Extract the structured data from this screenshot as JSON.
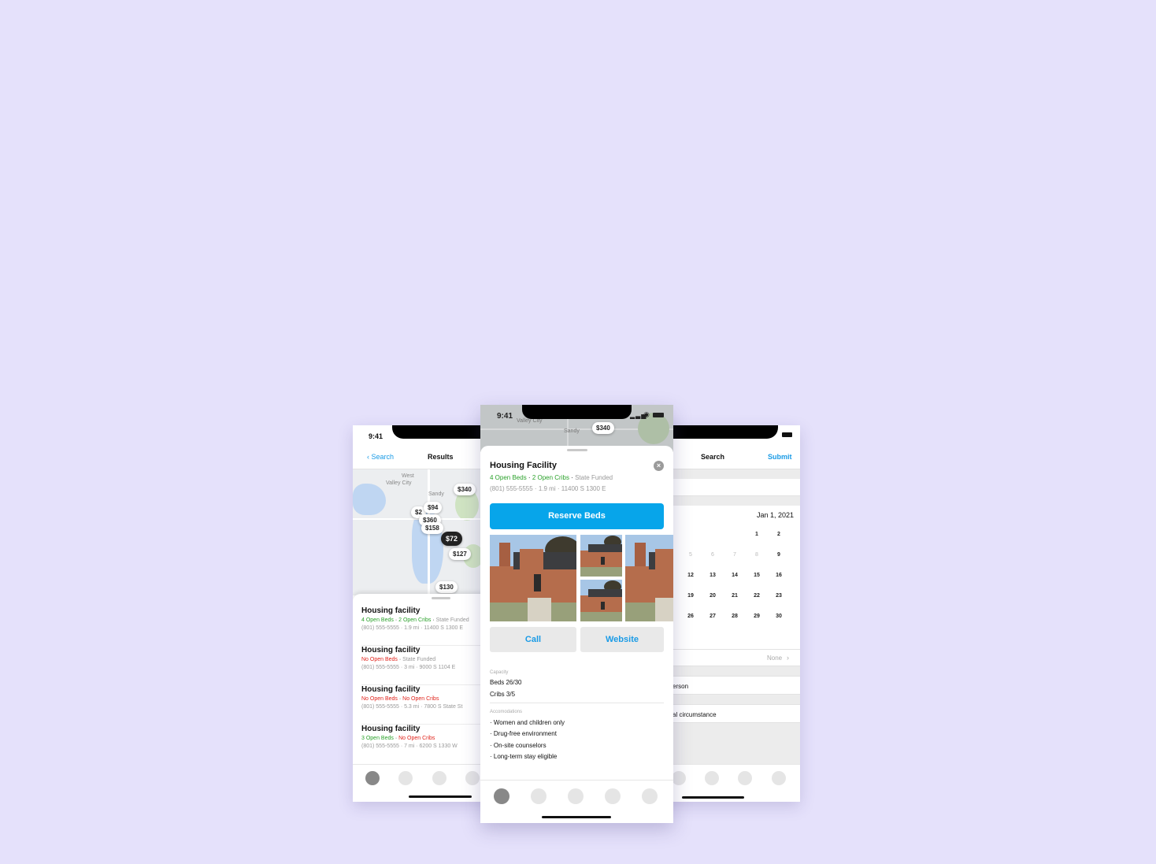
{
  "left_phone": {
    "time": "9:41",
    "back_label": "Search",
    "title": "Results",
    "map_labels": [
      "West",
      "Valley City",
      "Sandy"
    ],
    "map_pins": [
      "$340",
      "$94",
      "$2",
      "$360",
      "$158",
      "$72",
      "$127",
      "$130"
    ],
    "results": [
      {
        "name": "Housing facility",
        "beds": "4 Open Beds",
        "cribs": "2 Open Cribs",
        "funding": "State Funded",
        "contact": "(801) 555-5555 · 1.9 mi · 11400 S 1300 E"
      },
      {
        "name": "Housing facility",
        "beds": "No Open Beds",
        "cribs": "",
        "funding": "State Funded",
        "contact": "(801) 555-5555 · 3 mi · 9000 S 1104 E"
      },
      {
        "name": "Housing facility",
        "beds": "No Open Beds",
        "cribs": "No Open Cribs",
        "funding": "",
        "contact": "(801) 555-5555 · 5.3 mi · 7800 S State St"
      },
      {
        "name": "Housing facility",
        "beds": "3 Open Beds",
        "cribs": "No Open Cribs",
        "funding": "",
        "contact": "(801) 555-5555 · 7 mi · 6200 S 1330 W"
      }
    ]
  },
  "center_phone": {
    "time": "9:41",
    "map_labels": [
      "Valley City",
      "Sandy"
    ],
    "map_pin": "$340",
    "title": "Housing Facility",
    "beds": "4 Open Beds",
    "cribs": "2 Open Cribs",
    "funding": "State Funded",
    "contact": "(801) 555-5555 · 1.9 mi · 11400 S 1300 E",
    "reserve_label": "Reserve Beds",
    "call_label": "Call",
    "website_label": "Website",
    "capacity_label": "Capacity",
    "capacity_lines": [
      "Beds 26/30",
      "Cribs 3/5"
    ],
    "accommodations_label": "Accomodations",
    "accommodations": [
      "· Women and children only",
      "· Drug-free environment",
      "· On-site counselors",
      "· Long-term stay eligible"
    ]
  },
  "right_phone": {
    "title": "Search",
    "submit_label": "Submit",
    "date": "Jan 1, 2021",
    "calendar_rows": [
      [
        "",
        "",
        "",
        "1",
        "2"
      ],
      [
        "5",
        "6",
        "7",
        "8",
        "9"
      ],
      [
        "12",
        "13",
        "14",
        "15",
        "16"
      ],
      [
        "19",
        "20",
        "21",
        "22",
        "23"
      ],
      [
        "26",
        "27",
        "28",
        "29",
        "30"
      ]
    ],
    "none_label": "None",
    "row_person": "erson",
    "row_circumstance": "al circumstance"
  },
  "colors": {
    "background": "#e5e1fb",
    "accent": "#07a5ea",
    "link": "#1a9be6",
    "available": "#2aa12a",
    "unavailable": "#e0231b"
  }
}
